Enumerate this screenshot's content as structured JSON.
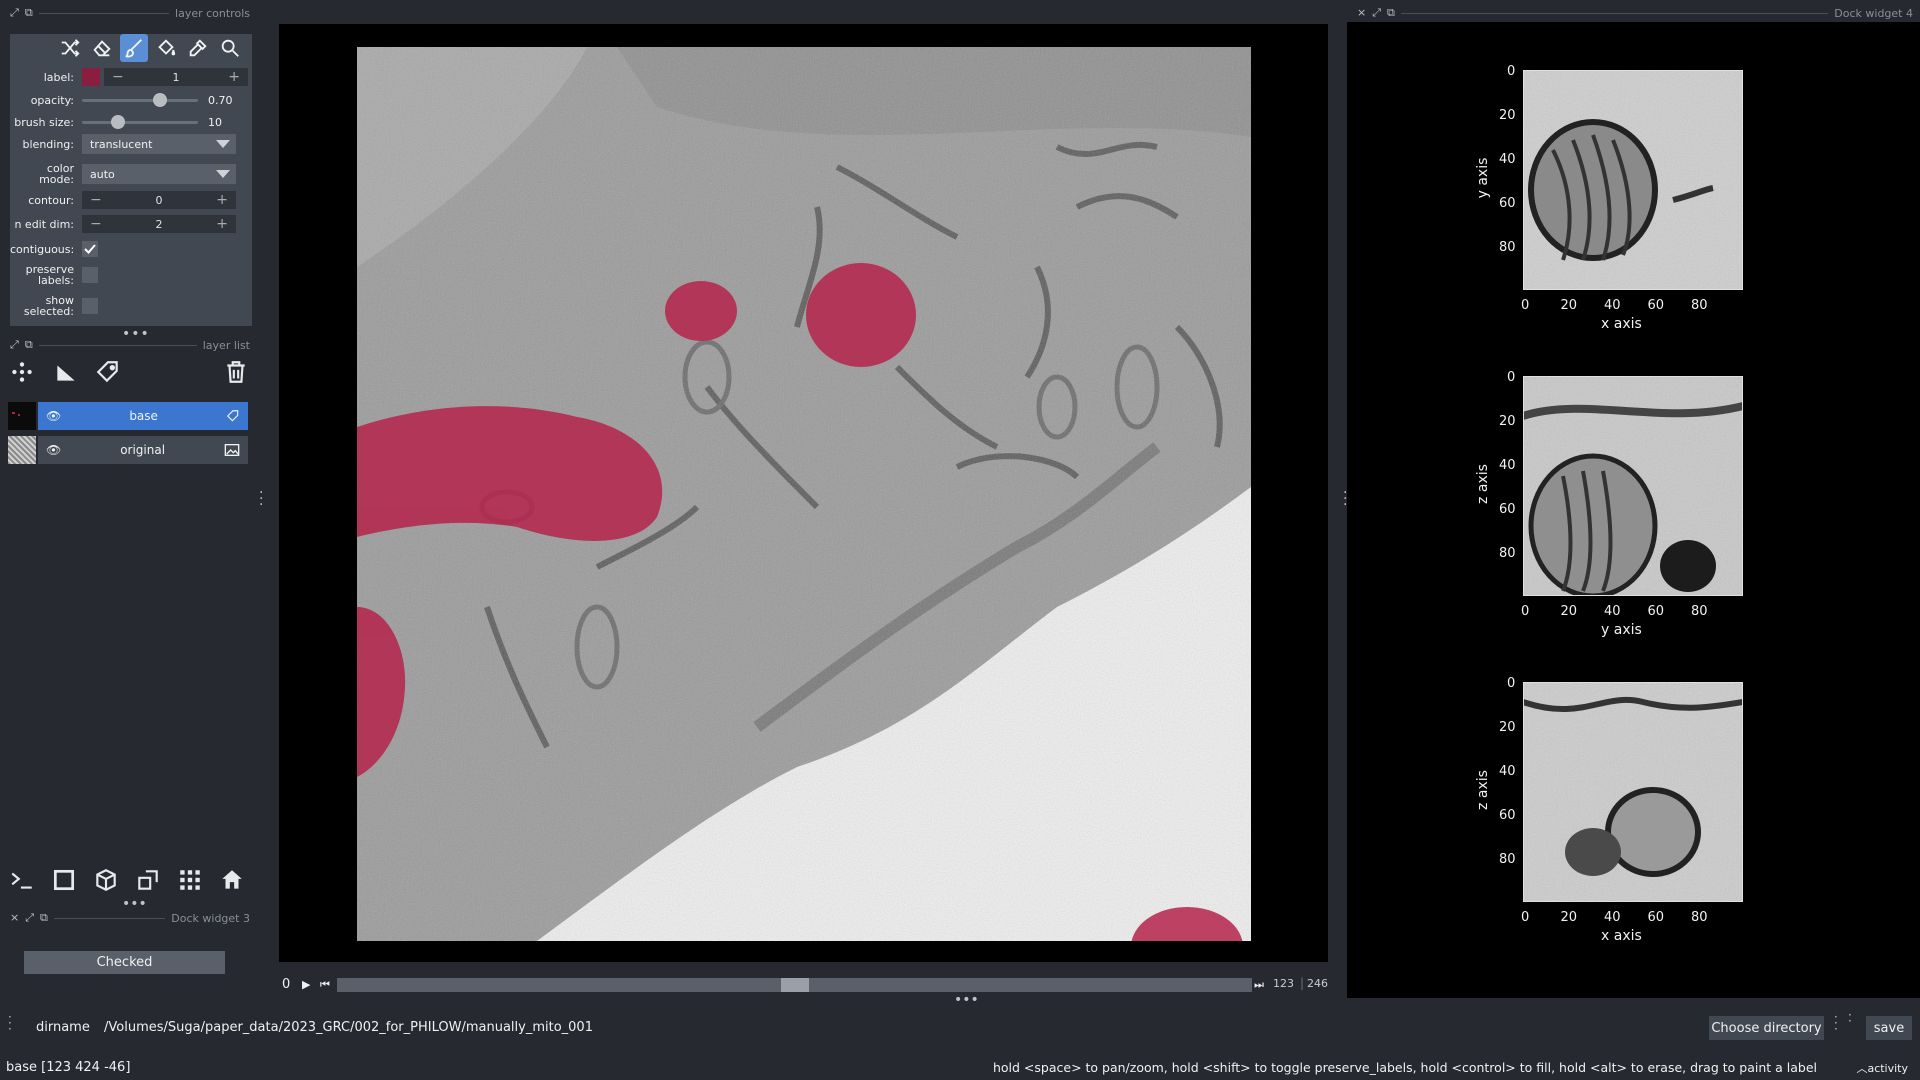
{
  "layer_controls": {
    "title": "layer controls",
    "label": {
      "label": "label:",
      "value": "1",
      "swatch": "#8b1e3f"
    },
    "opacity": {
      "label": "opacity:",
      "value": "0.70",
      "fraction": 0.7
    },
    "brush_size": {
      "label": "brush size:",
      "value": "10",
      "fraction": 0.28
    },
    "blending": {
      "label": "blending:",
      "value": "translucent"
    },
    "color_mode": {
      "label": "color mode:",
      "value": "auto"
    },
    "contour": {
      "label": "contour:",
      "value": "0"
    },
    "n_edit_dim": {
      "label": "n edit dim:",
      "value": "2"
    },
    "contiguous": {
      "label": "contiguous:",
      "checked": true
    },
    "preserve_labels": {
      "label_line1": "preserve",
      "label_line2": "labels:",
      "checked": false
    },
    "show_selected": {
      "label_line1": "show",
      "label_line2": "selected:",
      "checked": false
    },
    "tools": [
      "shuffle-icon",
      "eraser-icon",
      "brush-icon",
      "fill-icon",
      "picker-icon",
      "zoom-icon"
    ]
  },
  "layer_list": {
    "title": "layer list",
    "layers": [
      {
        "name": "base",
        "selected": true,
        "type_icon": "label-icon"
      },
      {
        "name": "original",
        "selected": false,
        "type_icon": "image-icon"
      }
    ]
  },
  "dock3": {
    "title": "Dock widget 3",
    "button": "Checked"
  },
  "dock4": {
    "title": "Dock widget 4"
  },
  "plots": [
    {
      "xlabel": "x axis",
      "ylabel": "y axis"
    },
    {
      "xlabel": "y axis",
      "ylabel": "z axis"
    },
    {
      "xlabel": "x axis",
      "ylabel": "z axis"
    }
  ],
  "plot_ticks": {
    "x": [
      "0",
      "20",
      "40",
      "60",
      "80"
    ],
    "y": [
      "0",
      "20",
      "40",
      "60",
      "80"
    ]
  },
  "dims": {
    "current": "0",
    "slider_value": "123",
    "slider_max": "246",
    "fraction": 0.5
  },
  "dirname": {
    "label": "dirname",
    "value": "/Volumes/Suga/paper_data/2023_GRC/002_for_PHILOW/manually_mito_001",
    "choose": "Choose directory",
    "save": "save"
  },
  "status": {
    "left": "base [123 424 -46]",
    "help": "hold <space> to pan/zoom, hold <shift> to toggle preserve_labels, hold <control> to fill, hold <alt> to erase, drag to paint a label",
    "activity": "activity"
  },
  "colors": {
    "accent": "#3b77cf",
    "label_red": "#b5234b",
    "panel": "#414851",
    "bg": "#262930"
  }
}
